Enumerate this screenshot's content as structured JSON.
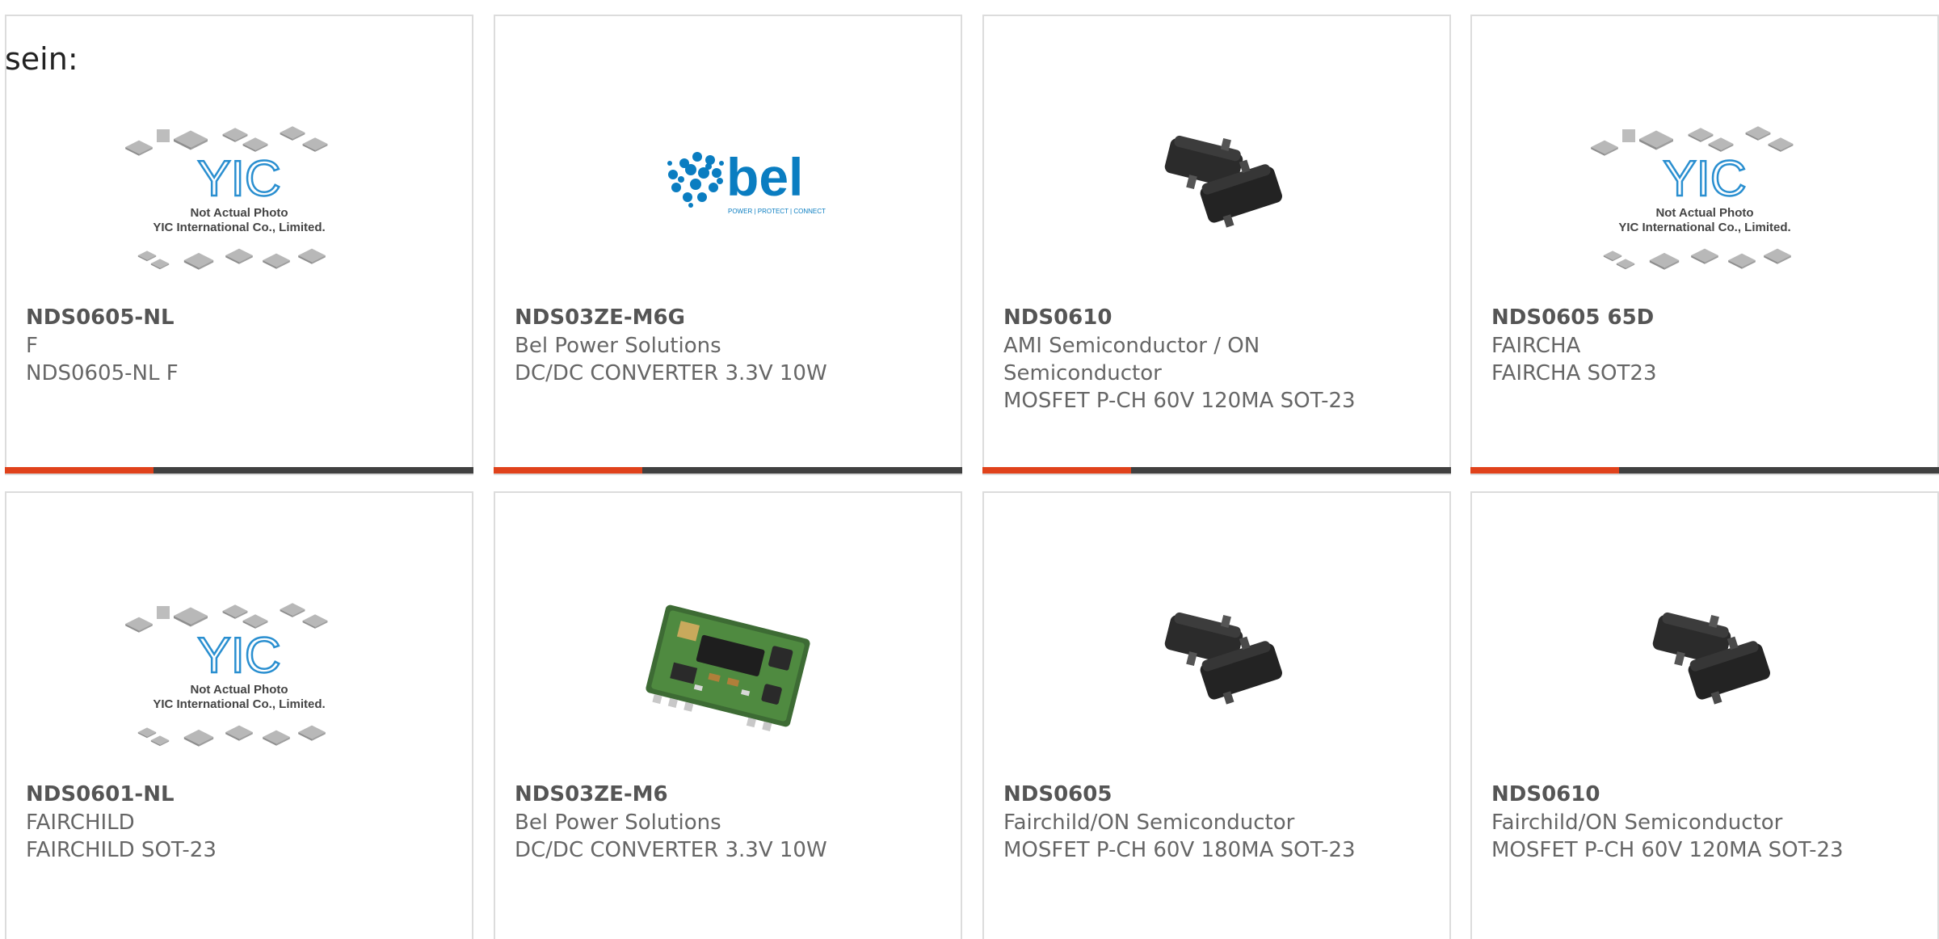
{
  "heading": "sein:",
  "colors": {
    "accent": "#e0421b",
    "bar": "#404040",
    "border": "#dcdcdc",
    "part_number": "#555555",
    "text": "#666666",
    "bel_blue": "#0a7dc1"
  },
  "cards": [
    {
      "part_number": "NDS0605-NL",
      "manufacturer": "F",
      "description": "NDS0605-NL F",
      "image": "placeholder-icon"
    },
    {
      "part_number": "NDS03ZE-M6G",
      "manufacturer": "Bel Power Solutions",
      "description": "DC/DC CONVERTER 3.3V 10W",
      "image": "bel-logo-icon",
      "logo_text": "bel",
      "logo_tagline": "POWER | PROTECT | CONNECT"
    },
    {
      "part_number": "NDS0610",
      "manufacturer": "AMI Semiconductor / ON Semiconductor",
      "description": "MOSFET P-CH 60V 120MA SOT-23",
      "image": "sot23-chip-icon"
    },
    {
      "part_number": "NDS0605 65D",
      "manufacturer": "FAIRCHA",
      "description": "FAIRCHA SOT23",
      "image": "placeholder-icon"
    },
    {
      "part_number": "NDS0601-NL",
      "manufacturer": "FAIRCHILD",
      "description": "FAIRCHILD SOT-23",
      "image": "placeholder-icon"
    },
    {
      "part_number": "NDS03ZE-M6",
      "manufacturer": "Bel Power Solutions",
      "description": "DC/DC CONVERTER 3.3V 10W",
      "image": "pcb-module-icon"
    },
    {
      "part_number": "NDS0605",
      "manufacturer": "Fairchild/ON Semiconductor",
      "description": "MOSFET P-CH 60V 180MA SOT-23",
      "image": "sot23-chip-icon"
    },
    {
      "part_number": "NDS0610",
      "manufacturer": "Fairchild/ON Semiconductor",
      "description": "MOSFET P-CH 60V 120MA SOT-23",
      "image": "sot23-chip-icon"
    }
  ],
  "placeholder": {
    "brand": "YIC",
    "line1": "Not Actual Photo",
    "line2": "YIC International Co., Limited."
  }
}
